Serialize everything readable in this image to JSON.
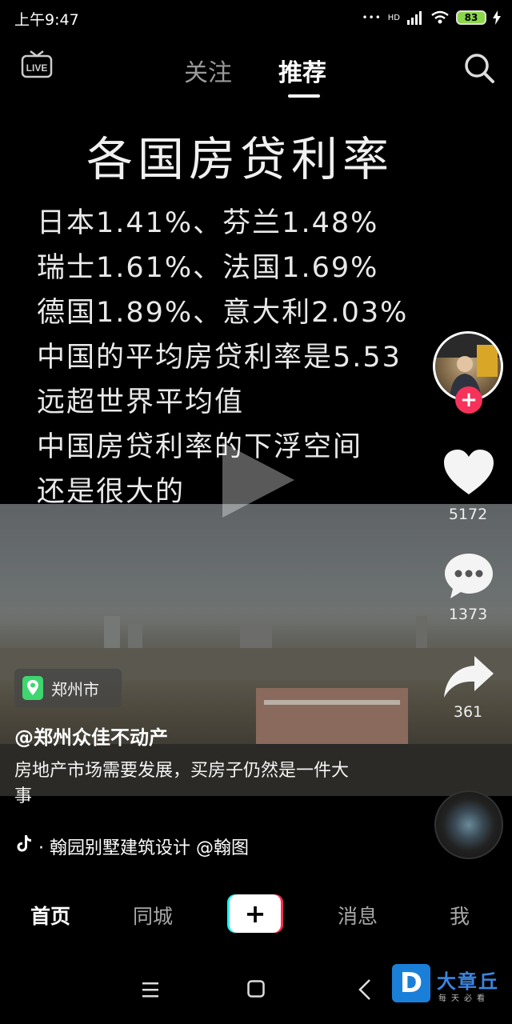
{
  "status_bar": {
    "time": "上午9:47",
    "network": "HD",
    "battery": "83"
  },
  "header": {
    "live_icon": "live-tv-icon",
    "tabs": [
      {
        "label": "关注"
      },
      {
        "label": "推荐"
      }
    ],
    "active_tab": "推荐",
    "search_icon": "search-icon"
  },
  "video": {
    "title": "各国房贷利率",
    "lines": [
      "日本1.41%、芬兰1.48%",
      "瑞士1.61%、法国1.69%",
      "德国1.89%、意大利2.03%",
      "中国的平均房贷利率是5.53",
      "远超世界平均值",
      "中国房贷利率的下浮空间",
      "还是很大的"
    ]
  },
  "actions": {
    "likes": "5172",
    "comments": "1373",
    "shares": "361"
  },
  "location": {
    "label": "郑州市"
  },
  "author": {
    "name": "@郑州众佳不动产"
  },
  "description": "房地产市场需要发展，买房子仍然是一件大事",
  "music": {
    "text": "· 翰园别墅建筑设计    @翰图"
  },
  "bottom_nav": {
    "items": [
      {
        "label": "首页"
      },
      {
        "label": "同城"
      },
      {
        "label": "消息"
      },
      {
        "label": "我"
      }
    ],
    "add_label": "+"
  },
  "watermark": {
    "logo": "D",
    "name": "大章丘",
    "slogan": "每天必看"
  },
  "colors": {
    "accent_red": "#f7325a",
    "tab_active": "#ffffff",
    "tab_inactive": "#9a9a9a"
  }
}
